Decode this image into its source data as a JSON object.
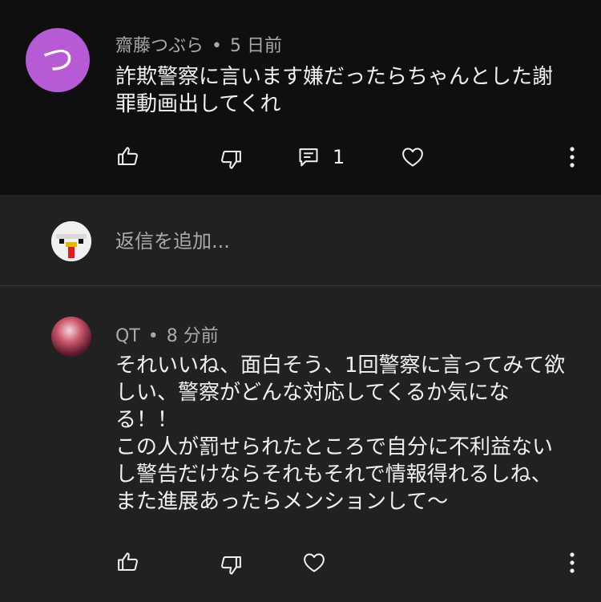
{
  "comment1": {
    "avatar_letter": "つ",
    "author": "齋藤つぶら",
    "separator": "•",
    "time": "5 日前",
    "text_lines": [
      "詐欺警察に言います嫌だったらちゃんとした謝",
      "罪動画出してくれ"
    ],
    "reply_count": "1"
  },
  "reply_box": {
    "placeholder": "返信を追加..."
  },
  "comment2": {
    "author": "QT",
    "separator": "•",
    "time": "8 分前",
    "text_lines": [
      "それいいね、面白そう、1回警察に言ってみて欲",
      "しい、警察がどんな対応してくるか気にな",
      "る！！",
      "この人が罰せられたところで自分に不利益ない",
      "し警告だけならそれもそれで情報得れるしね、",
      "また進展あったらメンションして〜"
    ]
  },
  "icons": {
    "like": "thumb-up-icon",
    "dislike": "thumb-down-icon",
    "reply": "comment-icon",
    "heart": "heart-icon",
    "more": "more-vertical-icon"
  },
  "colors": {
    "background_top": "#0f0f0f",
    "background_lower": "#212121",
    "avatar_purple": "#b65ad6",
    "text_primary": "#f1f1f1",
    "text_secondary": "#aaaaaa"
  }
}
